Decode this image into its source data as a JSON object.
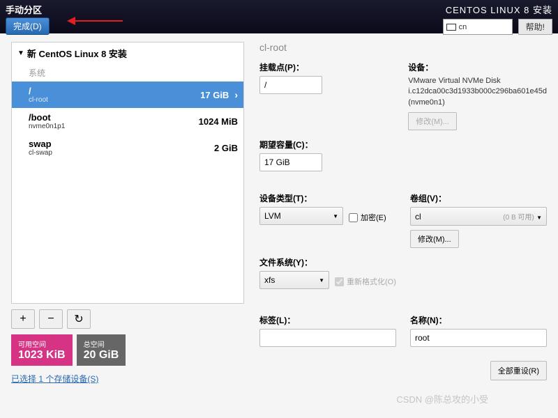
{
  "header": {
    "title_left": "手动分区",
    "done_btn": "完成(D)",
    "title_right": "CENTOS LINUX 8 安装",
    "lang": "cn",
    "help": "帮助!"
  },
  "tree": {
    "title": "新 CentOS Linux 8 安装",
    "section": "系统",
    "items": [
      {
        "name": "/",
        "sub": "cl-root",
        "size": "17 GiB",
        "selected": true
      },
      {
        "name": "/boot",
        "sub": "nvme0n1p1",
        "size": "1024 MiB",
        "selected": false
      },
      {
        "name": "swap",
        "sub": "cl-swap",
        "size": "2 GiB",
        "selected": false
      }
    ]
  },
  "space": {
    "avail_label": "可用空间",
    "avail_value": "1023 KiB",
    "total_label": "总空间",
    "total_value": "20 GiB"
  },
  "storage_link": "已选择 1 个存储设备(S)",
  "detail": {
    "title": "cl-root",
    "mount_label": "挂载点(P)：",
    "mount_value": "/",
    "capacity_label": "期望容量(C)：",
    "capacity_value": "17 GiB",
    "device_label": "设备：",
    "device_text": "VMware Virtual NVMe Disk i.c12dca00c3d1933b000c296ba601e45d (nvme0n1)",
    "modify_btn": "修改(M)...",
    "type_label": "设备类型(T)：",
    "type_value": "LVM",
    "encrypt_label": "加密(E)",
    "vg_label": "卷组(V)：",
    "vg_value": "cl",
    "vg_sub": "(0 B 可用)",
    "modify_vg": "修改(M)...",
    "fs_label": "文件系统(Y)：",
    "fs_value": "xfs",
    "reformat_label": "重新格式化(O)",
    "tag_label": "标签(L)：",
    "tag_value": "",
    "name_label": "名称(N)：",
    "name_value": "root"
  },
  "reset_btn": "全部重设(R)",
  "watermark": "CSDN @陈总攻的小受"
}
